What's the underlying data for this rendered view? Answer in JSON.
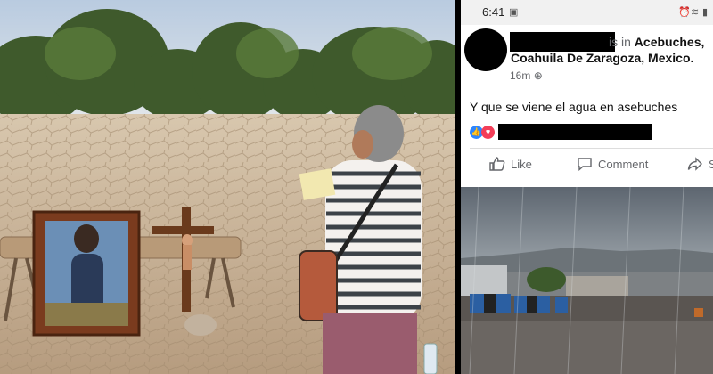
{
  "statusbar": {
    "time": "6:41"
  },
  "post": {
    "is_in": "is in",
    "location_line1": "Acebuches,",
    "location_line2": "Coahuila De Zaragoza, Mexico.",
    "time_ago": "16m",
    "text": "Y que se viene el agua en asebuches"
  },
  "actions": {
    "like": "Like",
    "comment": "Comment",
    "share": "S"
  },
  "colors": {
    "fb_blue": "#2d86ff",
    "fb_red": "#f33e58",
    "muted": "#65676b"
  }
}
